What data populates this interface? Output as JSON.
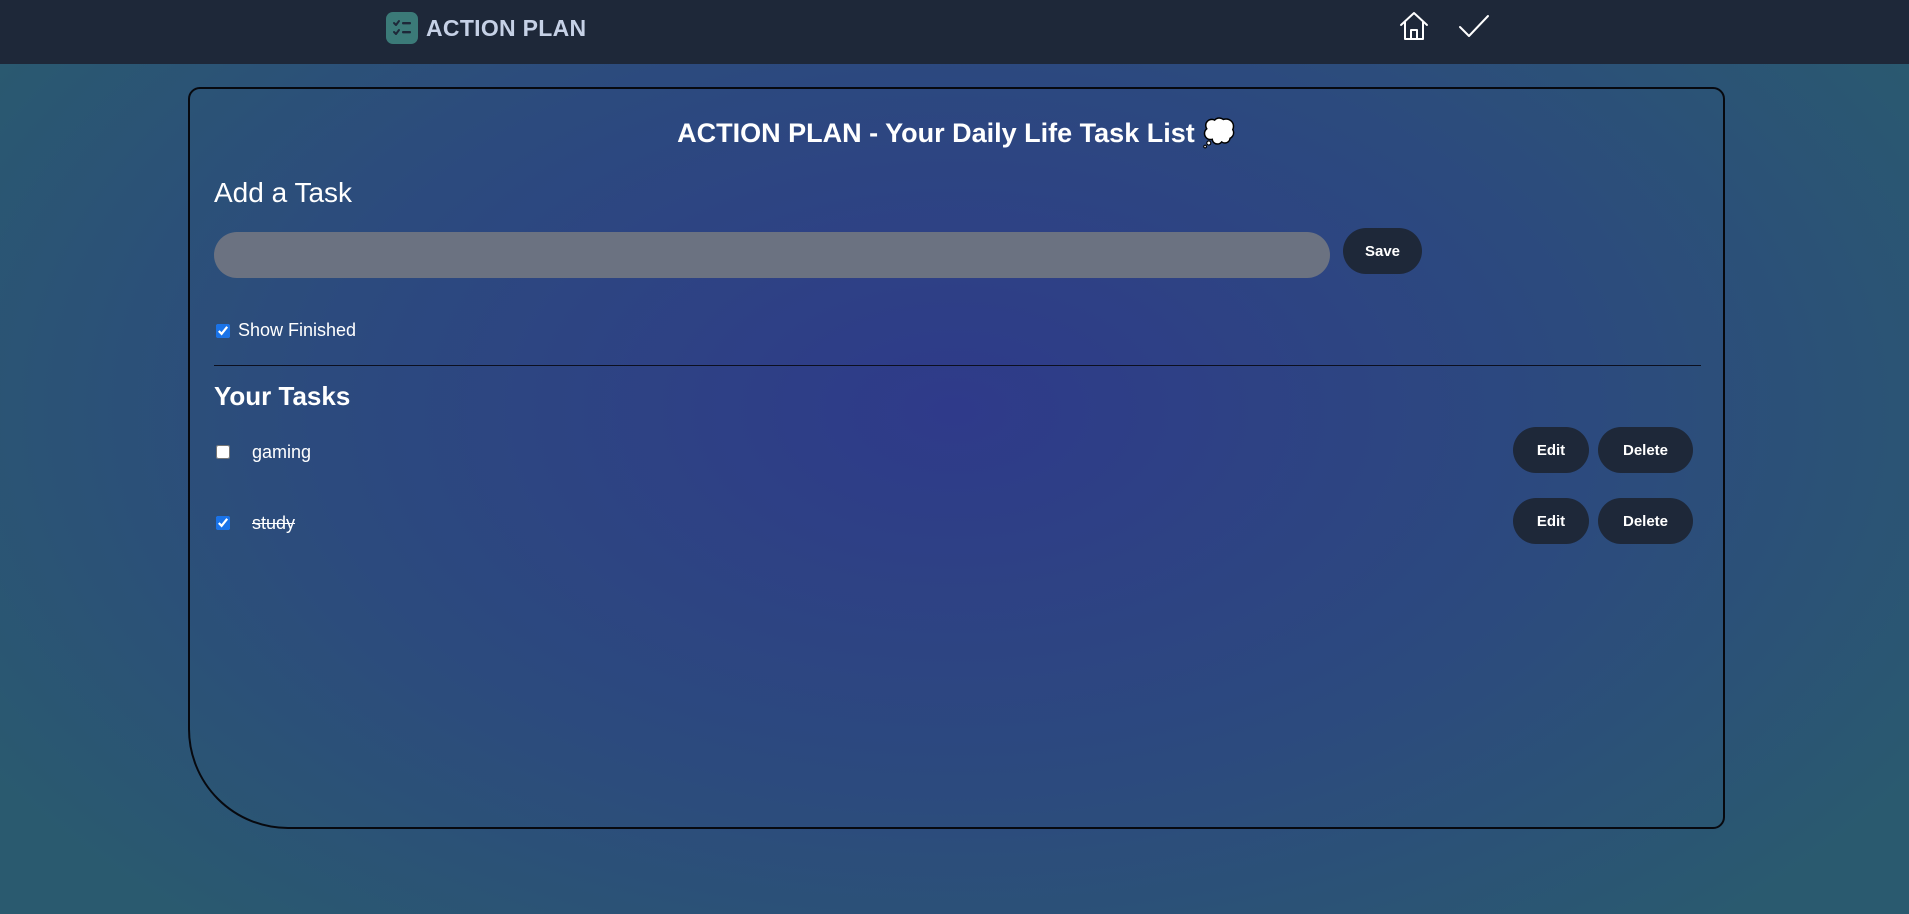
{
  "navbar": {
    "brand_title": "ACTION PLAN",
    "icons": [
      "checklist-logo-icon",
      "home-icon",
      "check-icon"
    ]
  },
  "main": {
    "title": "ACTION PLAN - Your Daily Life Task List 💭",
    "add_section_title": "Add a Task",
    "input_value": "",
    "save_label": "Save",
    "show_finished_label": "Show Finished",
    "show_finished_checked": true,
    "tasks_section_title": "Your Tasks",
    "tasks": [
      {
        "text": "gaming",
        "done": false,
        "edit_label": "Edit",
        "delete_label": "Delete"
      },
      {
        "text": "study",
        "done": true,
        "edit_label": "Edit",
        "delete_label": "Delete"
      }
    ]
  },
  "colors": {
    "navbar": "#1e2839",
    "button": "#1e2839",
    "input": "#6b7281",
    "logo": "#3b7a78"
  }
}
